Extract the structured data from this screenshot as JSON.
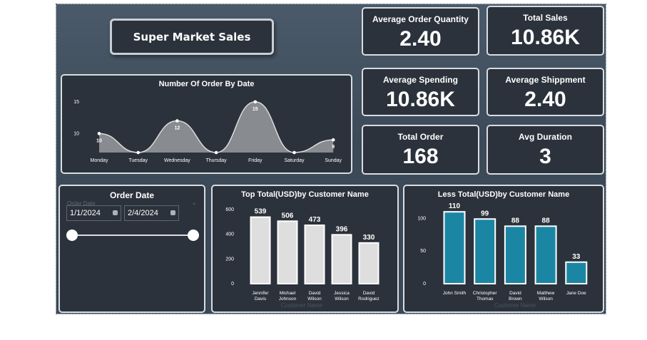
{
  "dashboard_title": "Super Market Sales",
  "kpis": {
    "avg_order_qty": {
      "label": "Average Order Quantity",
      "value": "2.40"
    },
    "total_sales": {
      "label": "Total Sales",
      "value": "10.86K"
    },
    "avg_spending": {
      "label": "Average Spending",
      "value": "10.86K"
    },
    "avg_shipment": {
      "label": "Average Shippment",
      "value": "2.40"
    },
    "total_order": {
      "label": "Total Order",
      "value": "168"
    },
    "avg_duration": {
      "label": "Avg Duration",
      "value": "3"
    }
  },
  "slicer": {
    "title": "Order Date",
    "field_label": "Order Date",
    "start": "1/1/2024",
    "end": "2/4/2024"
  },
  "colors": {
    "teal": "#1b86a4",
    "light_bar": "#dedede",
    "area": "#8d9094"
  },
  "chart_data": [
    {
      "type": "area",
      "title": "Number Of Order By Date",
      "categories": [
        "Monday",
        "Tuesday",
        "Wednesday",
        "Thursday",
        "Friday",
        "Saturday",
        "Sunday"
      ],
      "values": [
        10,
        7,
        12,
        7,
        15,
        7,
        9
      ],
      "data_labels": [
        "10",
        "",
        "12",
        "",
        "15",
        "",
        "9"
      ],
      "yticks": [
        "10",
        "15"
      ],
      "ylim": [
        7,
        16
      ]
    },
    {
      "type": "bar",
      "title": "Top Total(USD)by Customer Name",
      "xlabel": "Customer Name",
      "categories": [
        [
          "Jennifer",
          "Davis"
        ],
        [
          "Michael",
          "Johnson"
        ],
        [
          "David",
          "Wilson"
        ],
        [
          "Jessica",
          "Wilson"
        ],
        [
          "David",
          "Rodriguez"
        ]
      ],
      "values": [
        539,
        506,
        473,
        396,
        330
      ],
      "yticks": [
        "0",
        "200",
        "400",
        "600"
      ],
      "ylim": [
        0,
        600
      ]
    },
    {
      "type": "bar",
      "title": "Less Total(USD)by Customer Name",
      "xlabel": "Customer Name",
      "categories": [
        [
          "John Smith"
        ],
        [
          "Christopher",
          "Thomas"
        ],
        [
          "David",
          "Brown"
        ],
        [
          "Matthew",
          "Wilson"
        ],
        [
          "Jane Doe"
        ]
      ],
      "values": [
        110,
        99,
        88,
        88,
        33
      ],
      "yticks": [
        "0",
        "50",
        "100"
      ],
      "ylim": [
        0,
        120
      ]
    }
  ]
}
